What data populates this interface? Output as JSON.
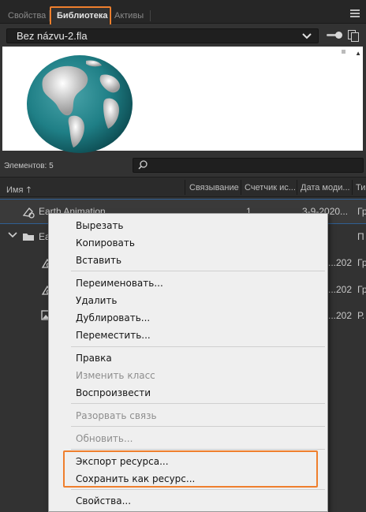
{
  "tabs": [
    {
      "label": "Свойства"
    },
    {
      "label": "Библиотека"
    },
    {
      "label": "Активы"
    }
  ],
  "document": {
    "name": "Bez názvu-2.fla"
  },
  "library": {
    "count_label": "Элементов: 5",
    "columns": [
      "Имя",
      "Связывание",
      "Счетчик ис...",
      "Дата моди...",
      "Ти"
    ],
    "rows": [
      {
        "name": "Earth Animation",
        "count": "1",
        "date": "3-9-2020...",
        "type": "Гр"
      },
      {
        "name": "Ea",
        "count": "",
        "date": "",
        "type": "П"
      },
      {
        "name": "",
        "count": "",
        "date": "...202...",
        "type": "Гр"
      },
      {
        "name": "",
        "count": "",
        "date": "...202...",
        "type": "Гр"
      },
      {
        "name": "",
        "count": "",
        "date": "...202...",
        "type": "Р."
      }
    ]
  },
  "context_menu": {
    "items": [
      {
        "label": "Вырезать",
        "enabled": true
      },
      {
        "label": "Копировать",
        "enabled": true
      },
      {
        "label": "Вставить",
        "enabled": true
      },
      {
        "label": "Переименовать...",
        "enabled": true
      },
      {
        "label": "Удалить",
        "enabled": true
      },
      {
        "label": "Дублировать...",
        "enabled": true
      },
      {
        "label": "Переместить...",
        "enabled": true
      },
      {
        "label": "Правка",
        "enabled": true
      },
      {
        "label": "Изменить класс",
        "enabled": false
      },
      {
        "label": "Воспроизвести",
        "enabled": true
      },
      {
        "label": "Разорвать связь",
        "enabled": false
      },
      {
        "label": "Обновить...",
        "enabled": false
      },
      {
        "label": "Экспорт ресурса...",
        "enabled": true
      },
      {
        "label": "Сохранить как ресурс...",
        "enabled": true
      },
      {
        "label": "Свойства...",
        "enabled": true
      }
    ]
  },
  "colors": {
    "highlight": "#ef7f2d",
    "selection_border": "#2f5f94",
    "globe": "#1f7f86"
  }
}
